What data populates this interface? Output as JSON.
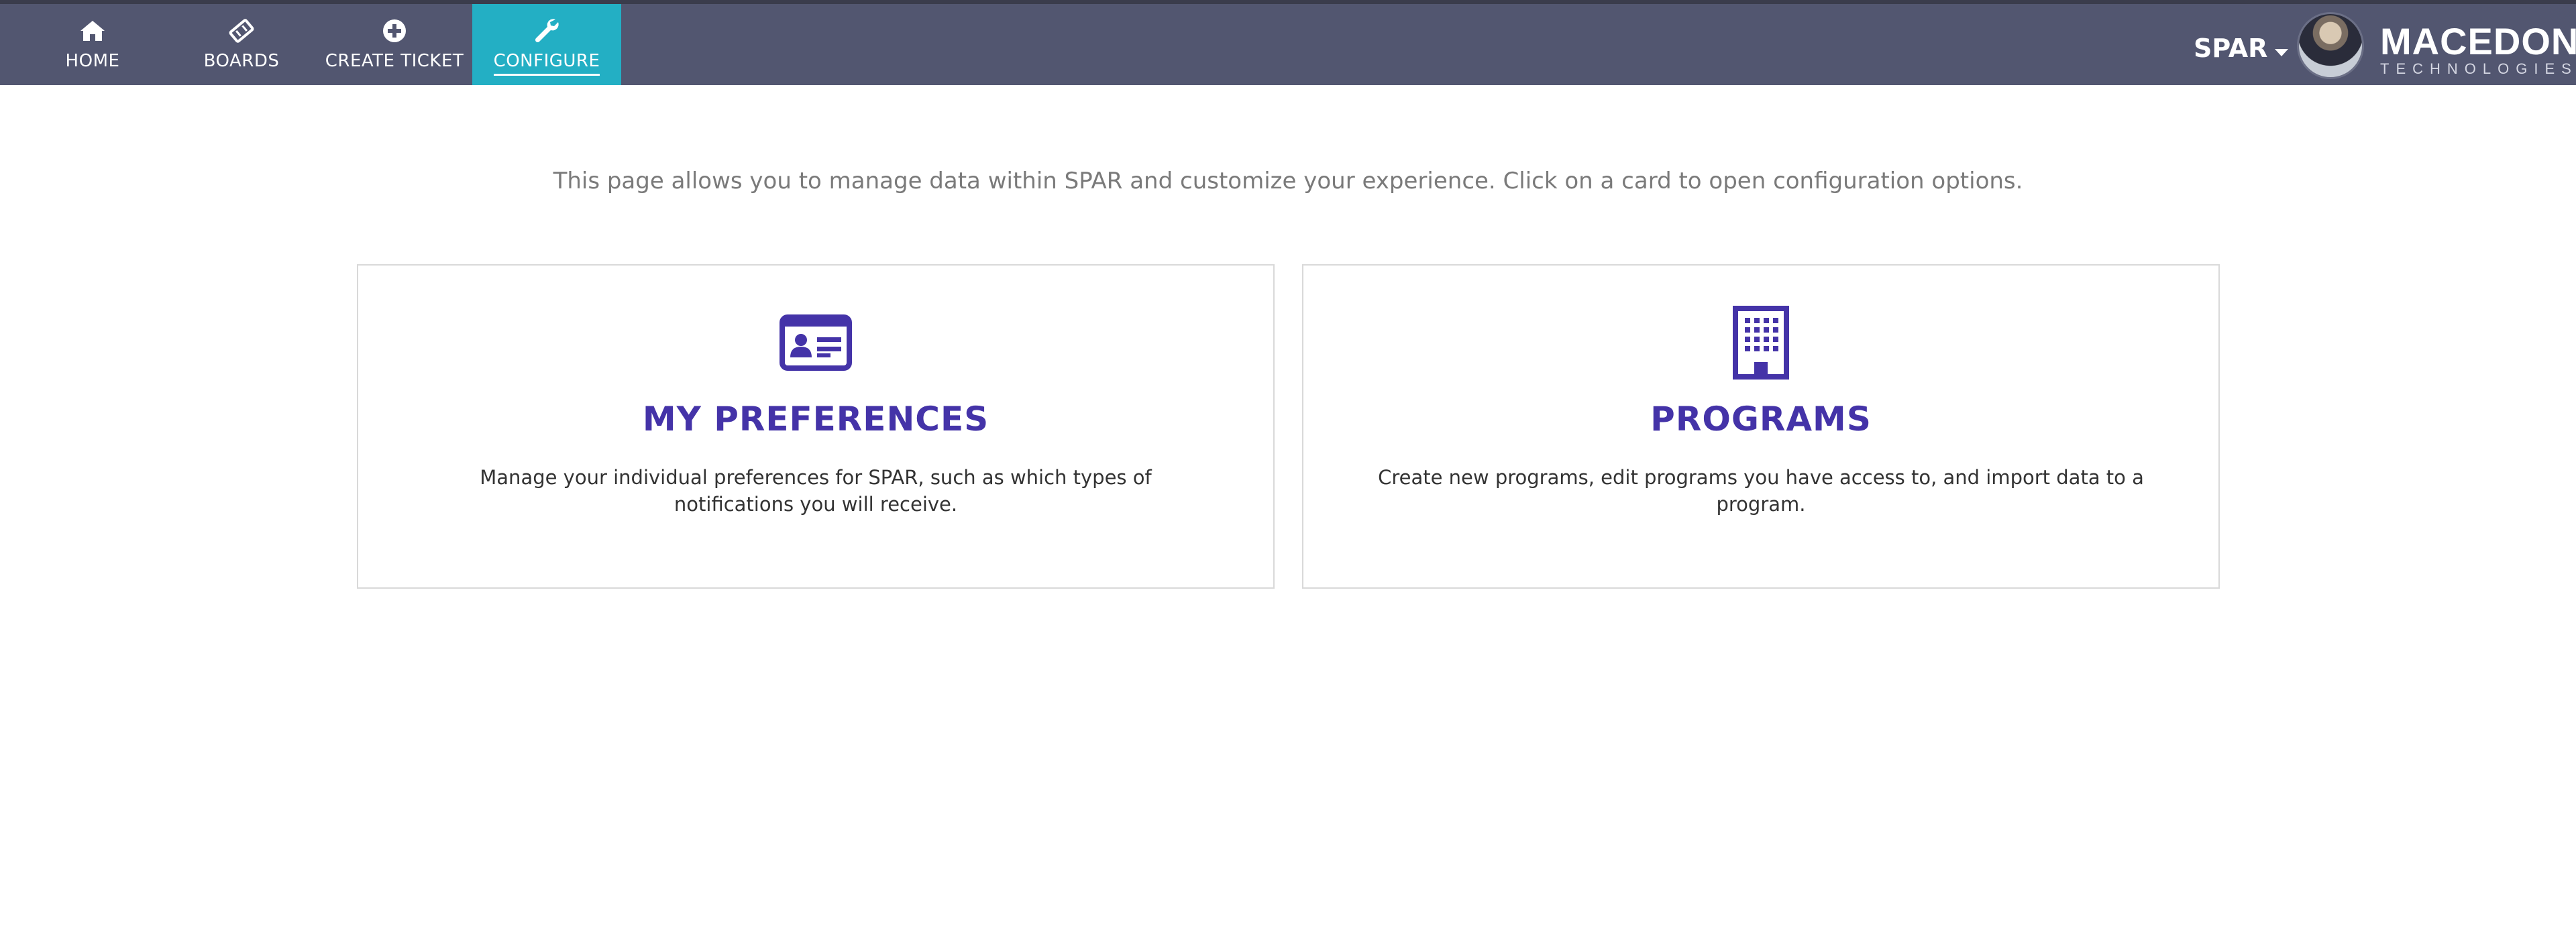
{
  "nav": {
    "items": [
      {
        "label": "HOME",
        "icon": "home-icon"
      },
      {
        "label": "BOARDS",
        "icon": "ticket-icon"
      },
      {
        "label": "CREATE TICKET",
        "icon": "plus-circle-icon"
      },
      {
        "label": "CONFIGURE",
        "icon": "wrench-icon",
        "active": true
      }
    ],
    "app_menu": "SPAR",
    "brand_name": "MACEDON",
    "brand_sub": "TECHNOLOGIES"
  },
  "main": {
    "intro": "This page allows you to manage data within SPAR and customize your experience. Click on a card to open configuration options.",
    "cards": [
      {
        "title": "MY PREFERENCES",
        "description": "Manage your individual preferences for SPAR, such as which types of notifications you will receive.",
        "icon": "id-card-icon"
      },
      {
        "title": "PROGRAMS",
        "description": "Create new programs, edit programs you have access to, and import data to a program.",
        "icon": "building-icon"
      }
    ]
  },
  "colors": {
    "nav_background": "#525670",
    "nav_active": "#23afc4",
    "accent": "#4433a8",
    "card_border": "#d9d9d9"
  }
}
